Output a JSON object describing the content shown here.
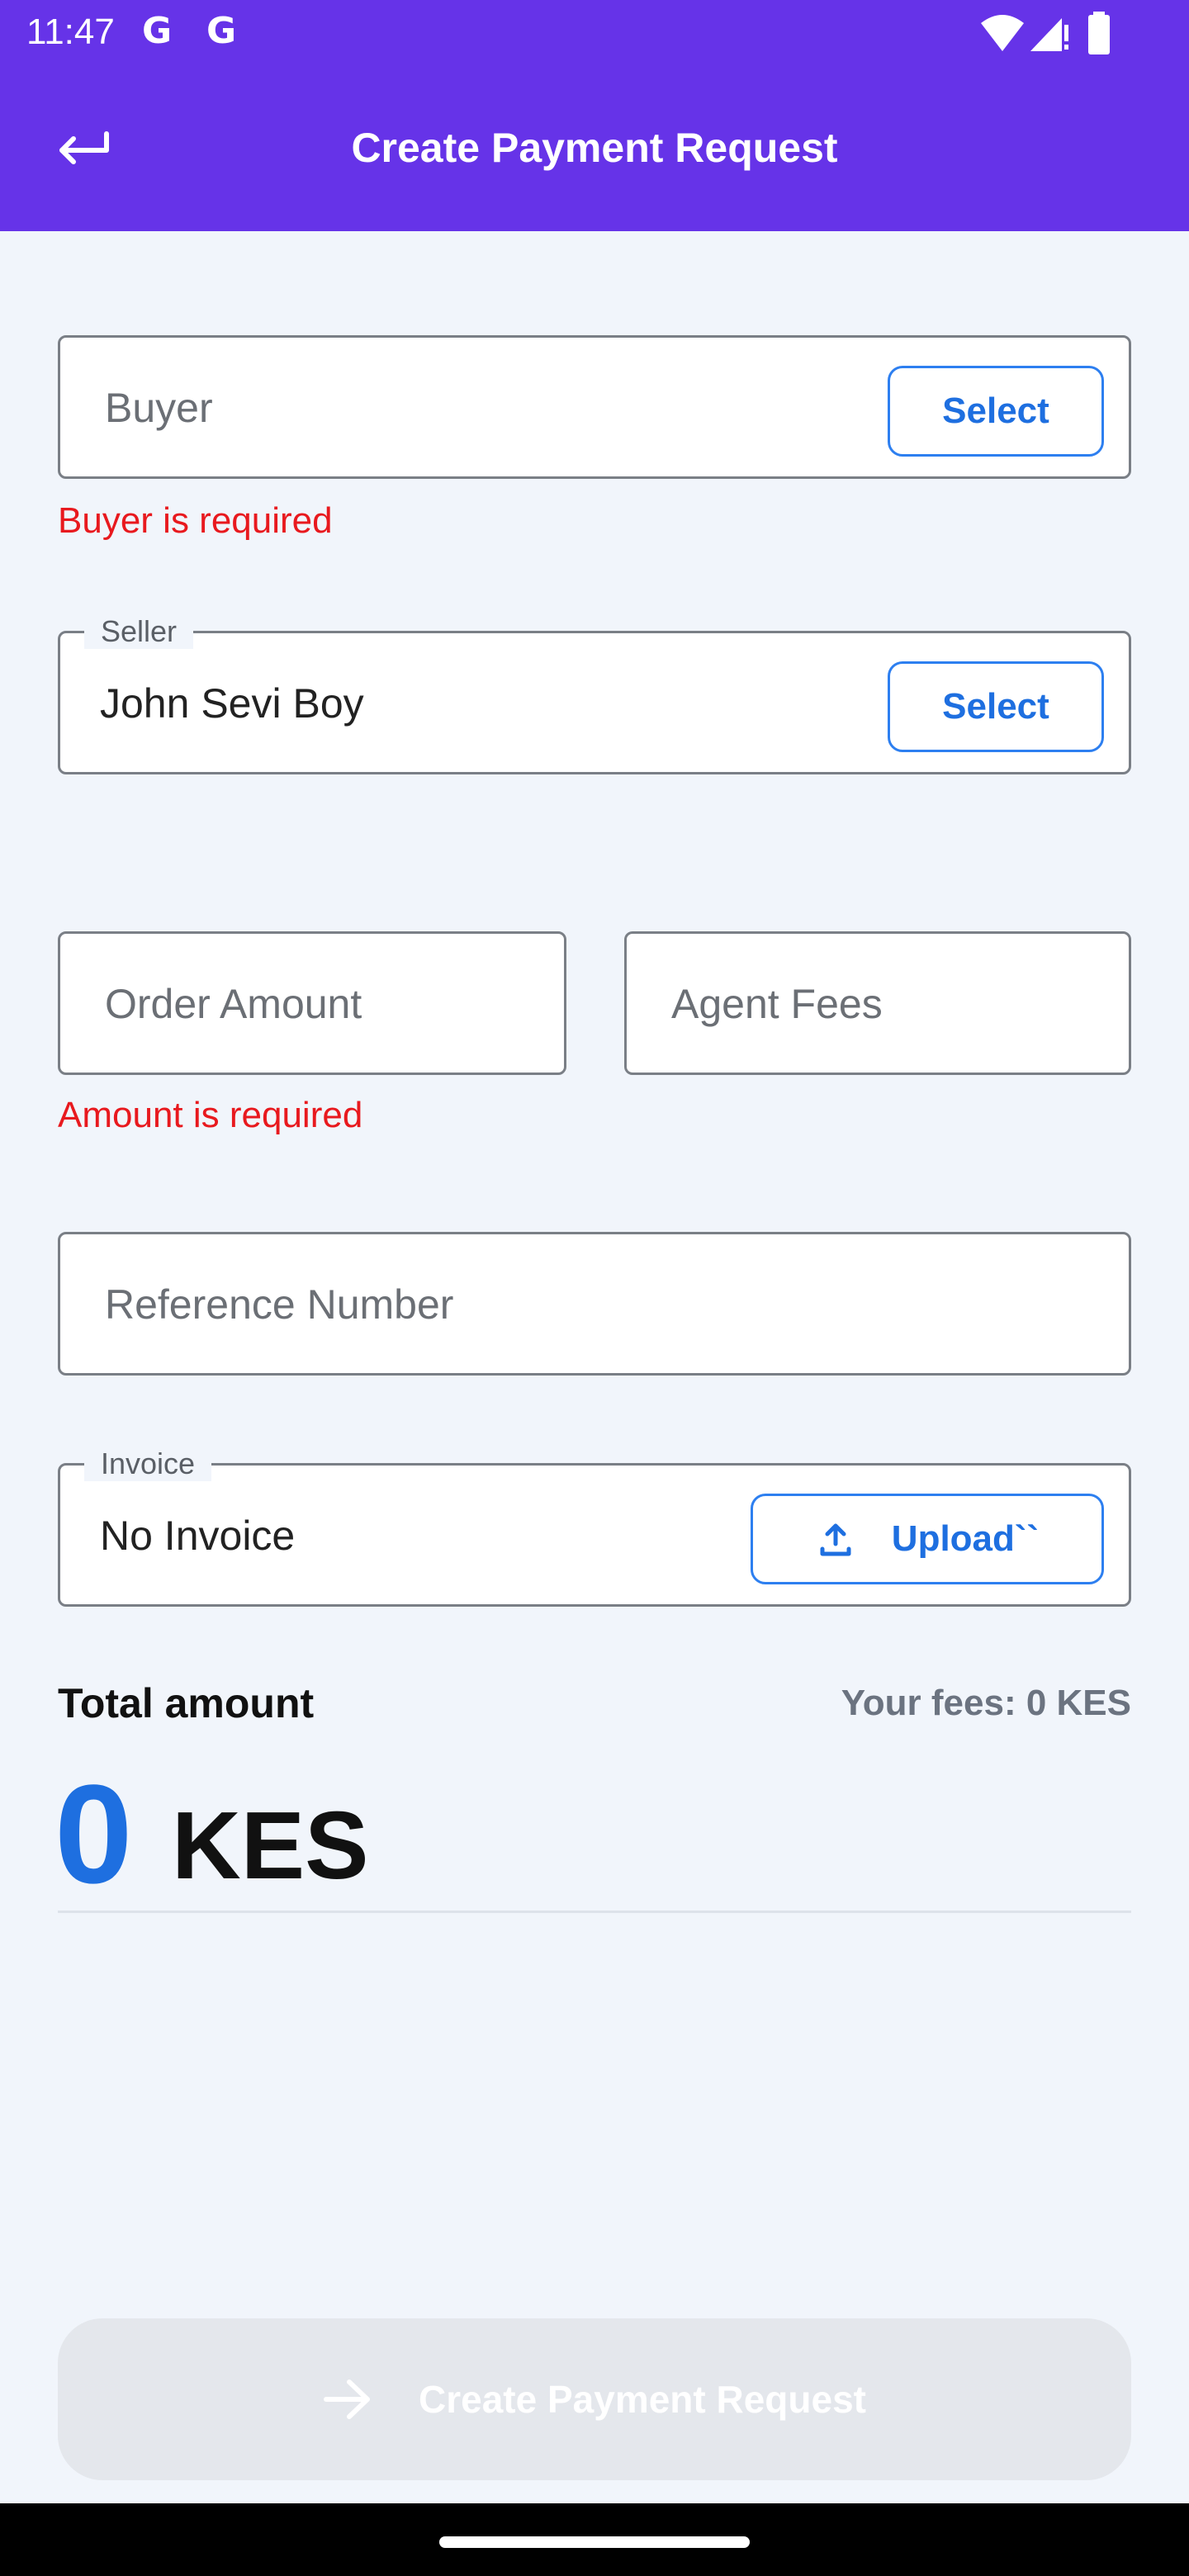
{
  "status_bar": {
    "time": "11:47",
    "g1": "G",
    "g2": "G"
  },
  "header": {
    "title": "Create Payment Request"
  },
  "buyer": {
    "placeholder": "Buyer",
    "select_label": "Select",
    "error": "Buyer is required"
  },
  "seller": {
    "label": "Seller",
    "value": "John Sevi Boy",
    "select_label": "Select"
  },
  "order_amount": {
    "placeholder": "Order Amount",
    "error": "Amount is required"
  },
  "agent_fees": {
    "placeholder": "Agent Fees"
  },
  "reference": {
    "placeholder": "Reference Number"
  },
  "invoice": {
    "label": "Invoice",
    "value": "No Invoice",
    "upload_label": "Upload``"
  },
  "total": {
    "label": "Total amount",
    "fees": "Your fees: 0 KES",
    "amount": "0",
    "currency": "KES"
  },
  "submit": {
    "label": "Create Payment Request"
  },
  "colors": {
    "primary": "#6633e8",
    "accent": "#1e6fe0",
    "error": "#e8191e"
  }
}
